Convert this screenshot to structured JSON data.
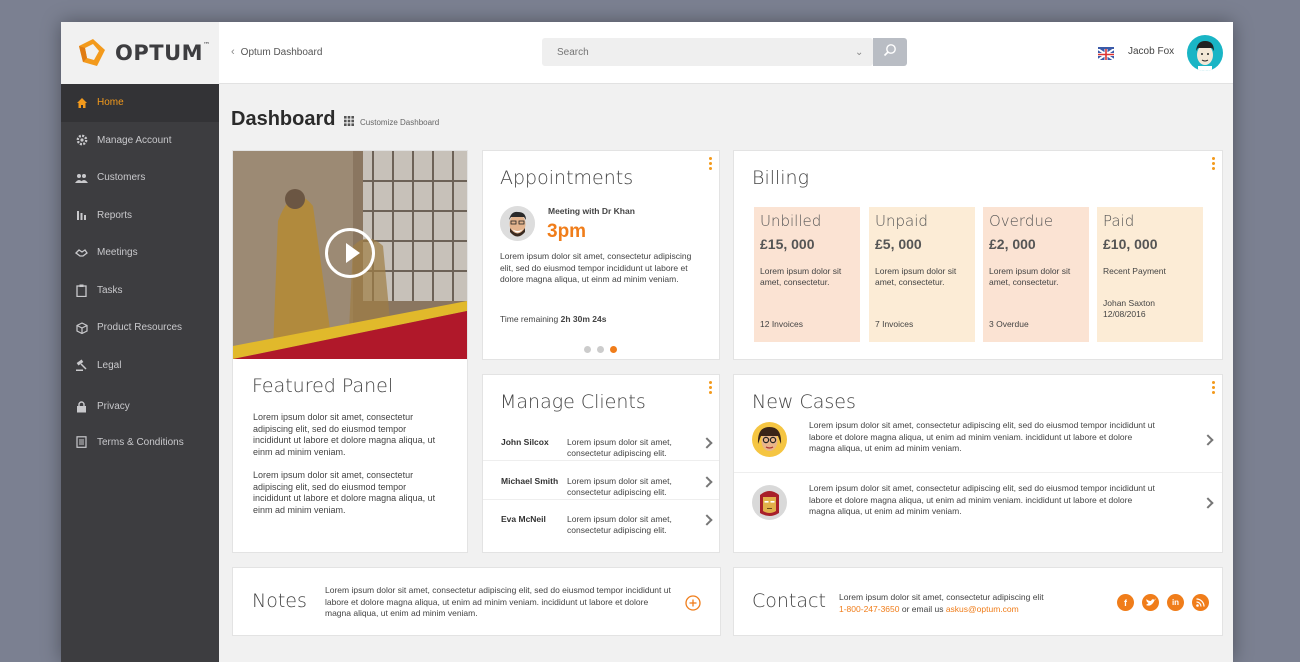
{
  "brand": {
    "name": "OPTUM",
    "tm": "™",
    "accent": "#f39a1c",
    "orange": "#f07d1a",
    "sidebar_bg": "#3d3d40"
  },
  "sidebar": {
    "items": [
      {
        "label": "Home",
        "icon": "home-icon",
        "active": true
      },
      {
        "label": "Manage Account",
        "icon": "gear-icon"
      },
      {
        "label": "Customers",
        "icon": "users-icon"
      },
      {
        "label": "Reports",
        "icon": "bar-chart-icon"
      },
      {
        "label": "Meetings",
        "icon": "handshake-icon"
      },
      {
        "label": "Tasks",
        "icon": "clipboard-icon"
      },
      {
        "label": "Product Resources",
        "icon": "box-icon"
      },
      {
        "label": "Legal",
        "icon": "gavel-icon"
      },
      {
        "label": "Privacy",
        "icon": "lock-icon"
      },
      {
        "label": "Terms & Conditions",
        "icon": "document-icon"
      }
    ]
  },
  "header": {
    "breadcrumb": "Optum Dashboard",
    "search_placeholder": "Search",
    "user_name": "Jacob Fox"
  },
  "page": {
    "title": "Dashboard",
    "customize_label": "Customize Dashboard"
  },
  "featured": {
    "title": "Featured Panel",
    "para1": "Lorem ipsum dolor sit amet, consectetur adipiscing elit, sed do eiusmod tempor incididunt ut labore et dolore magna aliqua, ut einm ad minim veniam.",
    "para2": "Lorem ipsum dolor sit amet, consectetur adipiscing elit, sed do eiusmod tempor incididunt ut labore et dolore magna aliqua, ut einm ad minim veniam."
  },
  "appointments": {
    "title": "Appointments",
    "meeting": "Meeting with Dr Khan",
    "time": "3pm",
    "text": "Lorem ipsum dolor sit amet, consectetur adipiscing elit, sed do eiusmod tempor incididunt ut labore et dolore magna aliqua, ut einm ad minim veniam.",
    "remaining_label": "Time remaining",
    "remaining_value": "2h 30m 24s"
  },
  "billing": {
    "title": "Billing",
    "tiles": [
      {
        "title": "Unbilled",
        "amount": "£15, 000",
        "text": "Lorem ipsum dolor sit amet, consectetur.",
        "foot": "12 Invoices",
        "color": "#fbe3d3"
      },
      {
        "title": "Unpaid",
        "amount": "£5, 000",
        "text": "Lorem ipsum dolor sit amet, consectetur.",
        "foot": "7 Invoices",
        "color": "#fcecd6"
      },
      {
        "title": "Overdue",
        "amount": "£2, 000",
        "text": "Lorem ipsum dolor sit amet, consectetur.",
        "foot": "3 Overdue",
        "color": "#fbe3d3"
      },
      {
        "title": "Paid",
        "amount": "£10, 000",
        "text": "Recent Payment",
        "foot": "Johan Saxton",
        "foot2": "12/08/2016",
        "color": "#fcecd6"
      }
    ]
  },
  "clients": {
    "title": "Manage Clients",
    "rows": [
      {
        "name": "John Silcox",
        "desc": "Lorem ipsum dolor sit amet, consectetur adipiscing elit."
      },
      {
        "name": "Michael Smith",
        "desc": "Lorem ipsum dolor sit amet, consectetur adipiscing elit."
      },
      {
        "name": "Eva McNeil",
        "desc": "Lorem ipsum dolor sit amet, consectetur adipiscing elit."
      }
    ]
  },
  "cases": {
    "title": "New Cases",
    "rows": [
      {
        "text": "Lorem ipsum dolor sit amet, consectetur adipiscing elit, sed do eiusmod tempor incididunt ut labore et dolore magna aliqua, ut enim ad minim veniam. incididunt ut labore et dolore magna aliqua, ut enim ad minim veniam."
      },
      {
        "text": "Lorem ipsum dolor sit amet, consectetur adipiscing elit, sed do eiusmod tempor incididunt ut labore et dolore magna aliqua, ut enim ad minim veniam. incididunt ut labore et dolore magna aliqua, ut enim ad minim veniam."
      }
    ]
  },
  "notes": {
    "title": "Notes",
    "text": "Lorem ipsum dolor sit amet, consectetur adipiscing elit, sed do eiusmod tempor incididunt ut labore et dolore magna aliqua, ut enim ad minim veniam. incididunt ut labore et dolore magna aliqua, ut enim ad minim veniam."
  },
  "contact": {
    "title": "Contact",
    "text": "Lorem ipsum dolor sit amet, consectetur adipiscing elit",
    "phone": "1-800-247-3650",
    "or_email": "or email us",
    "email": "askus@optum.com",
    "social": [
      "facebook-icon",
      "twitter-icon",
      "linkedin-icon",
      "rss-icon"
    ]
  }
}
